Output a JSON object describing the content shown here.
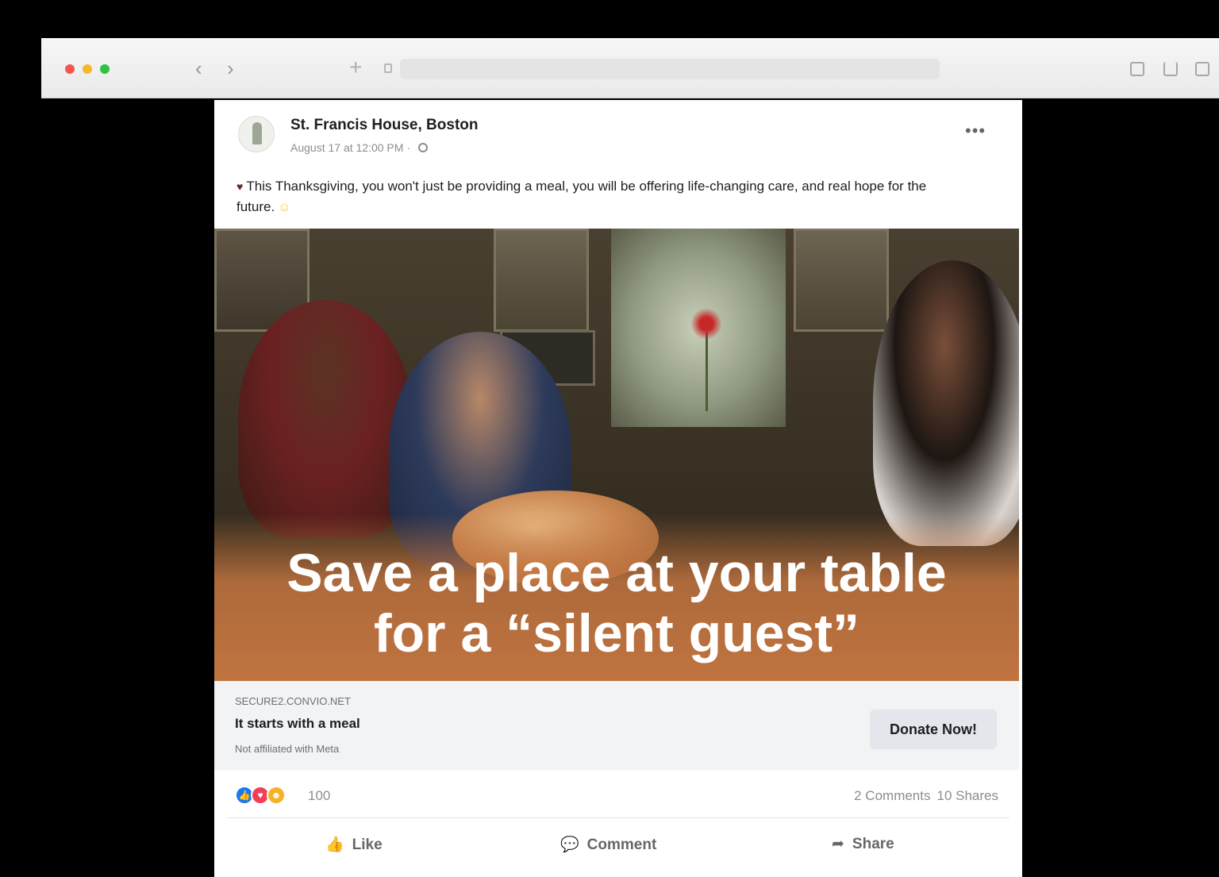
{
  "post": {
    "page_name": "St. Francis House, Boston",
    "timestamp": "August 17 at 12:00 PM · ",
    "text": "This Thanksgiving, you won't just be providing a meal, you will be offering life-changing care, and real hope for the future."
  },
  "ad": {
    "headline_line1": "Save a place at your table",
    "headline_line2": "for a “silent guest”"
  },
  "link_preview": {
    "domain": "SECURE2.CONVIO.NET",
    "title": "It starts with a meal",
    "disclaimer": "Not affiliated with Meta",
    "cta_label": "Donate Now!"
  },
  "engagement": {
    "reaction_count": "100",
    "comments": "2 Comments",
    "shares": "10 Shares"
  },
  "actions": {
    "like": "Like",
    "comment": "Comment",
    "share": "Share"
  }
}
